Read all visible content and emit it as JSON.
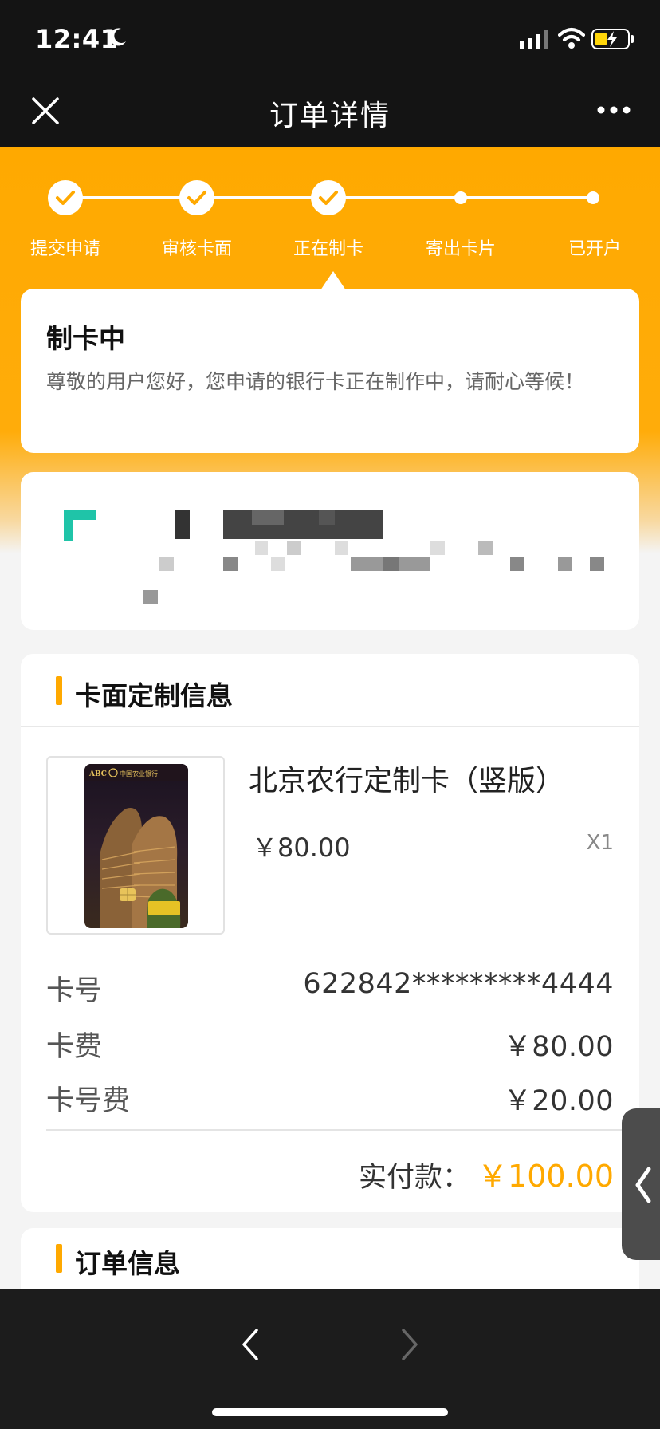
{
  "status_bar": {
    "time": "12:41"
  },
  "nav": {
    "title": "订单详情"
  },
  "steps": [
    {
      "label": "提交申请",
      "done": true
    },
    {
      "label": "审核卡面",
      "done": true
    },
    {
      "label": "正在制卡",
      "done": true
    },
    {
      "label": "寄出卡片",
      "done": false
    },
    {
      "label": "已开户",
      "done": false
    }
  ],
  "status": {
    "title": "制卡中",
    "description": "尊敬的用户您好，您申请的银行卡正在制作中，请耐心等候！"
  },
  "card_section": {
    "title": "卡面定制信息",
    "card_brand": "ABC",
    "card_bank": "中国农业银行",
    "product_name": "北京农行定制卡（竖版）",
    "price": "￥80.00",
    "quantity": "X1",
    "rows": [
      {
        "label": "卡号",
        "value": "622842*********4444"
      },
      {
        "label": "卡费",
        "value": "￥80.00"
      },
      {
        "label": "卡号费",
        "value": "￥20.00"
      }
    ],
    "total_label": "实付款：",
    "total_value": "￥100.00"
  },
  "order_section": {
    "title": "订单信息"
  },
  "colors": {
    "accent": "#ffa900",
    "dark_bar": "#141414",
    "side_tab": "#4c4c4c"
  },
  "icons": [
    "moon-icon",
    "signal-icon",
    "wifi-icon",
    "battery-icon",
    "close-icon",
    "more-icon",
    "check-icon",
    "back-arrow-icon",
    "forward-arrow-icon",
    "collapse-arrow-icon"
  ]
}
